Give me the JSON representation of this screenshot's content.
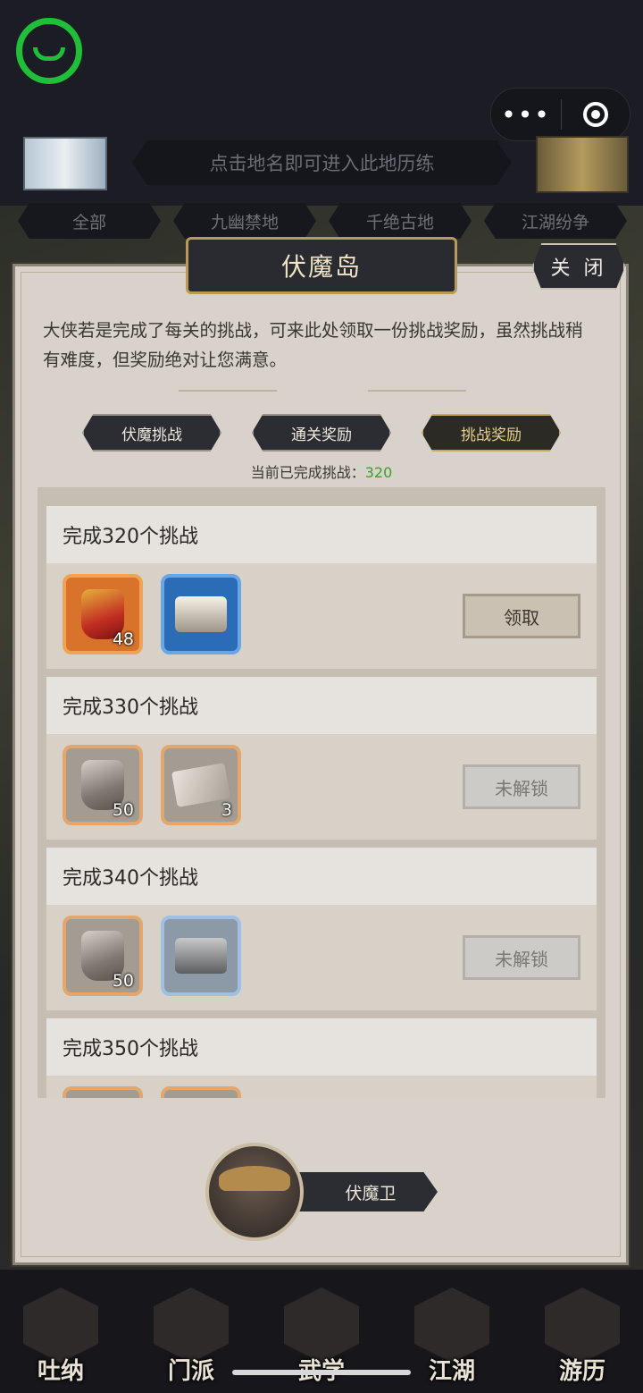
{
  "topbar": {
    "more_label": "•••",
    "hint": "点击地名即可进入此地历练",
    "map_tabs": [
      "全部",
      "九幽禁地",
      "千绝古地",
      "江湖纷争"
    ]
  },
  "dialog": {
    "title": "伏魔岛",
    "close_label": "关 闭",
    "intro": "大侠若是完成了每关的挑战，可来此处领取一份挑战奖励，虽然挑战稍有难度，但奖励绝对让您满意。",
    "tabs": [
      {
        "label": "伏魔挑战",
        "active": false
      },
      {
        "label": "通关奖励",
        "active": false
      },
      {
        "label": "挑战奖励",
        "active": true
      }
    ],
    "progress_label": "当前已完成挑战：",
    "progress_value": "320",
    "rewards": [
      {
        "title": "完成320个挑战",
        "items": [
          {
            "icon": "shield-item-icon",
            "qty": "48"
          },
          {
            "icon": "orb-item-icon",
            "qty": ""
          }
        ],
        "button": "领取",
        "status": "claimable"
      },
      {
        "title": "完成330个挑战",
        "items": [
          {
            "icon": "shield-item-icon",
            "qty": "50"
          },
          {
            "icon": "scroll-item-icon",
            "qty": "3"
          }
        ],
        "button": "未解锁",
        "status": "locked"
      },
      {
        "title": "完成340个挑战",
        "items": [
          {
            "icon": "shield-item-icon",
            "qty": "50"
          },
          {
            "icon": "orb-item-icon",
            "qty": ""
          }
        ],
        "button": "未解锁",
        "status": "locked"
      },
      {
        "title": "完成350个挑战",
        "items": [],
        "button": "",
        "status": "locked"
      }
    ],
    "npc_name": "伏魔卫"
  },
  "bottom_nav": [
    "吐纳",
    "门派",
    "武学",
    "江湖",
    "游历"
  ],
  "colors": {
    "accent_green": "#3aa02e",
    "logo_green": "#1fbf3a",
    "active_tab_text": "#e7cf8a"
  }
}
